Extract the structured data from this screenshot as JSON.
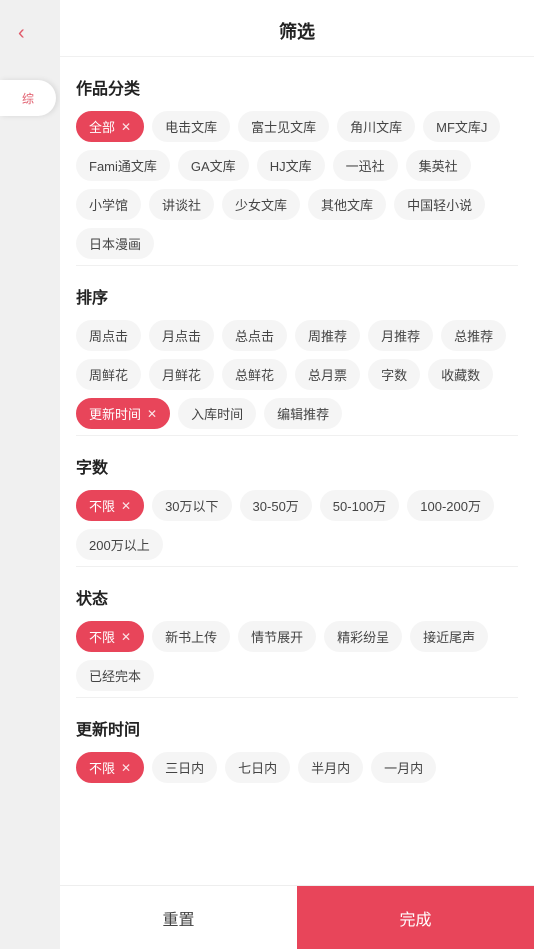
{
  "header": {
    "title": "筛选",
    "back_icon": "‹"
  },
  "sidebar": {
    "tab_label": "综"
  },
  "sections": {
    "category": {
      "title": "作品分类",
      "tags": [
        {
          "label": "全部",
          "active": true
        },
        {
          "label": "电击文库",
          "active": false
        },
        {
          "label": "富士见文库",
          "active": false
        },
        {
          "label": "角川文库",
          "active": false
        },
        {
          "label": "MF文库J",
          "active": false
        },
        {
          "label": "Fami通文库",
          "active": false
        },
        {
          "label": "GA文库",
          "active": false
        },
        {
          "label": "HJ文库",
          "active": false
        },
        {
          "label": "一迅社",
          "active": false
        },
        {
          "label": "集英社",
          "active": false
        },
        {
          "label": "小学馆",
          "active": false
        },
        {
          "label": "讲谈社",
          "active": false
        },
        {
          "label": "少女文库",
          "active": false
        },
        {
          "label": "其他文库",
          "active": false
        },
        {
          "label": "中国轻小说",
          "active": false
        },
        {
          "label": "日本漫画",
          "active": false
        }
      ]
    },
    "sort": {
      "title": "排序",
      "tags": [
        {
          "label": "周点击",
          "active": false
        },
        {
          "label": "月点击",
          "active": false
        },
        {
          "label": "总点击",
          "active": false
        },
        {
          "label": "周推荐",
          "active": false
        },
        {
          "label": "月推荐",
          "active": false
        },
        {
          "label": "总推荐",
          "active": false
        },
        {
          "label": "周鲜花",
          "active": false
        },
        {
          "label": "月鲜花",
          "active": false
        },
        {
          "label": "总鲜花",
          "active": false
        },
        {
          "label": "总月票",
          "active": false
        },
        {
          "label": "字数",
          "active": false
        },
        {
          "label": "收藏数",
          "active": false
        },
        {
          "label": "更新时间",
          "active": true
        },
        {
          "label": "入库时间",
          "active": false
        },
        {
          "label": "编辑推荐",
          "active": false
        }
      ]
    },
    "word_count": {
      "title": "字数",
      "tags": [
        {
          "label": "不限",
          "active": true
        },
        {
          "label": "30万以下",
          "active": false
        },
        {
          "label": "30-50万",
          "active": false
        },
        {
          "label": "50-100万",
          "active": false
        },
        {
          "label": "100-200万",
          "active": false
        },
        {
          "label": "200万以上",
          "active": false
        }
      ]
    },
    "status": {
      "title": "状态",
      "tags": [
        {
          "label": "不限",
          "active": true
        },
        {
          "label": "新书上传",
          "active": false
        },
        {
          "label": "情节展开",
          "active": false
        },
        {
          "label": "精彩纷呈",
          "active": false
        },
        {
          "label": "接近尾声",
          "active": false
        },
        {
          "label": "已经完本",
          "active": false
        }
      ]
    },
    "update_time": {
      "title": "更新时间",
      "tags": [
        {
          "label": "不限",
          "active": true
        },
        {
          "label": "三日内",
          "active": false
        },
        {
          "label": "七日内",
          "active": false
        },
        {
          "label": "半月内",
          "active": false
        },
        {
          "label": "一月内",
          "active": false
        }
      ]
    }
  },
  "footer": {
    "reset_label": "重置",
    "confirm_label": "完成"
  }
}
